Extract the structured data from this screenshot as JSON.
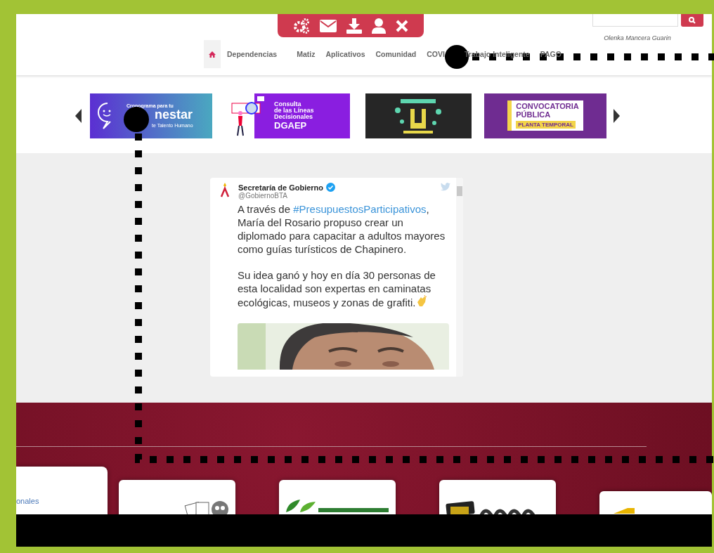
{
  "user_name": "Olenka Mancera Guarin",
  "nav": [
    {
      "kind": "home",
      "selected": true
    },
    {
      "kind": "link",
      "label": "Dependencias",
      "selected": false
    },
    {
      "kind": "link",
      "label": "Matiz",
      "selected": false
    },
    {
      "kind": "link",
      "label": "Aplicativos",
      "selected": false
    },
    {
      "kind": "link",
      "label": "Comunidad",
      "selected": false
    },
    {
      "kind": "link",
      "label": "COVI",
      "selected": false
    },
    {
      "kind": "link",
      "label": "Trabajo Inteligente",
      "selected": false
    },
    {
      "kind": "link",
      "label": "PAGO",
      "selected": false
    }
  ],
  "banners": [
    {
      "kind": "bienestar",
      "lines": [
        "Cronograma para tu",
        "nestar",
        "te Talento Humano"
      ]
    },
    {
      "kind": "consulta",
      "lines": [
        "Consulta",
        "de las Líneas",
        "Decisionales",
        "DGAEP"
      ]
    },
    {
      "kind": "picture"
    },
    {
      "kind": "convocatoria",
      "lines": [
        "CONVOCATORIA",
        "PÚBLICA",
        "PLANTA TEMPORAL"
      ]
    }
  ],
  "tweet": {
    "account": "Secretaría de Gobierno",
    "verified": true,
    "handle": "@GobiernoBTA",
    "paragraphs": [
      [
        {
          "text": "A través de "
        },
        {
          "text": "#PresupuestosParticipativos",
          "kind": "hashtag"
        },
        {
          "text": ", María del Rosario propuso crear un diplomado para capacitar a adultos mayores como guías turísticos de Chapinero."
        }
      ],
      [
        {
          "text": "Su idea ganó y hoy en día 30 personas de esta localidad son expertas en caminatas ecológicas, museos y zonas de grafiti."
        }
      ]
    ]
  },
  "footer_cards": [
    {
      "kind": "text",
      "text": "onales"
    },
    {
      "kind": "cards"
    },
    {
      "kind": "comparendo"
    },
    {
      "kind": "actua"
    },
    {
      "kind": "yellow"
    }
  ]
}
